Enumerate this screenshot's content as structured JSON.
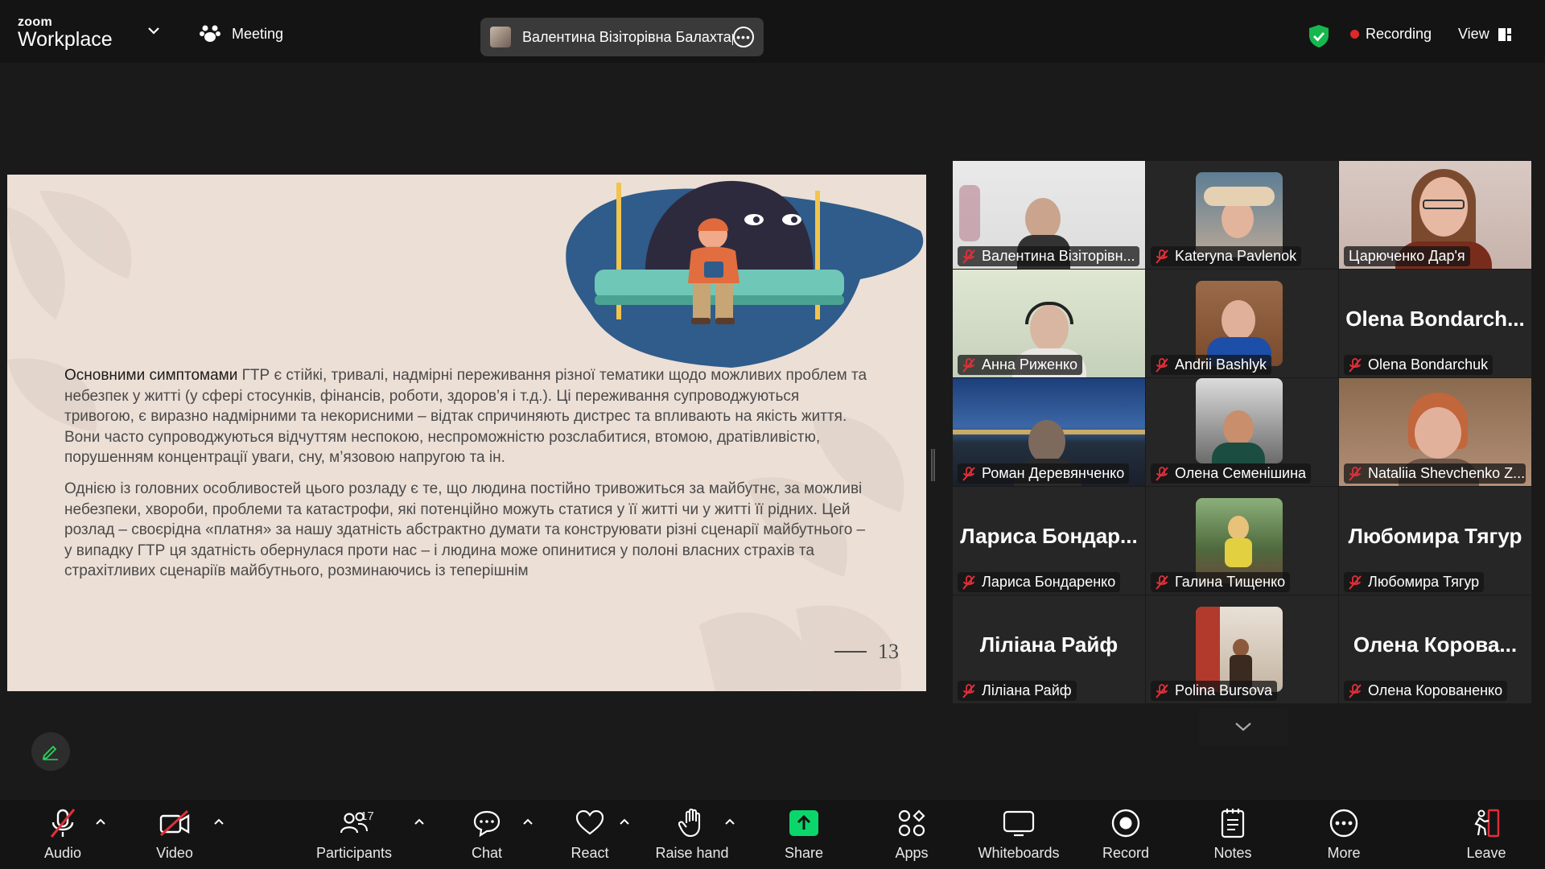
{
  "app": {
    "logo_line1": "zoom",
    "logo_line2": "Workplace"
  },
  "header": {
    "meeting_label": "Meeting",
    "active_speaker": "Валентина Візіторівна Балахтар'",
    "recording_label": "Recording",
    "view_label": "View"
  },
  "slide": {
    "p1_bold": "Основними симптомами",
    "p1_rest": " ГТР є стійкі, тривалі, надмірні переживання різної тематики щодо можливих проблем та небезпек у житті (у сфері стосунків, фінансів, роботи, здоров’я і т.д.). Ці переживання супроводжуються тривогою, є виразно надмірними та некорисними – відтак спричиняють дистрес та впливають на якість життя. Вони часто супроводжуються відчуттям неспокою, неспроможністю розслабитися, втомою, дратівливістю, порушенням  концентрації уваги, сну, м’язовою напругою та ін.",
    "p2": "Однією із головних особливостей цього розладу є те, що людина постійно тривожиться за майбутнє, за можливі небезпеки, хвороби, проблеми та катастрофи, які потенційно можуть статися у її житті чи у житті її рідних. Цей розлад – своєрідна «платня» за нашу здатність абстрактно думати та конструювати різні сценарії майбутнього – у випадку ГТР ця здатність обернулася проти нас – і людина може опинитися у полоні власних страхів та страхітливих сценаріїв майбутнього, розминаючись із теперішнім",
    "page_number": "13"
  },
  "participants": [
    {
      "name": "Валентина Візіторівн...",
      "big": ""
    },
    {
      "name": "Kateryna Pavlenok",
      "big": ""
    },
    {
      "name": "Царюченко Дар'я",
      "big": ""
    },
    {
      "name": "Анна Риженко",
      "big": ""
    },
    {
      "name": "Andrii Bashlyk",
      "big": ""
    },
    {
      "name": "Olena Bondarchuk",
      "big": "Olena  Bondarch..."
    },
    {
      "name": "Роман Деревянченко",
      "big": ""
    },
    {
      "name": "Олена Семенішина",
      "big": ""
    },
    {
      "name": "Nataliia Shevchenko Z...",
      "big": ""
    },
    {
      "name": "Лариса Бондаренко",
      "big": "Лариса  Бондар..."
    },
    {
      "name": "Галина Тищенко",
      "big": ""
    },
    {
      "name": "Любомира Тягур",
      "big": "Любомира Тягур"
    },
    {
      "name": "Ліліана Райф",
      "big": "Ліліана Райф"
    },
    {
      "name": "Polina Bursova",
      "big": ""
    },
    {
      "name": "Олена Корованенко",
      "big": "Олена  Корова..."
    }
  ],
  "toolbar": {
    "audio": "Audio",
    "video": "Video",
    "participants": "Participants",
    "participants_count": "17",
    "chat": "Chat",
    "react": "React",
    "raise_hand": "Raise hand",
    "share": "Share",
    "apps": "Apps",
    "whiteboards": "Whiteboards",
    "record": "Record",
    "notes": "Notes",
    "more": "More",
    "leave": "Leave"
  },
  "colors": {
    "active_speaker_border": "#23d959",
    "share_green": "#0bd66b",
    "recording_red": "#e02828",
    "mute_red": "#e0303a"
  }
}
